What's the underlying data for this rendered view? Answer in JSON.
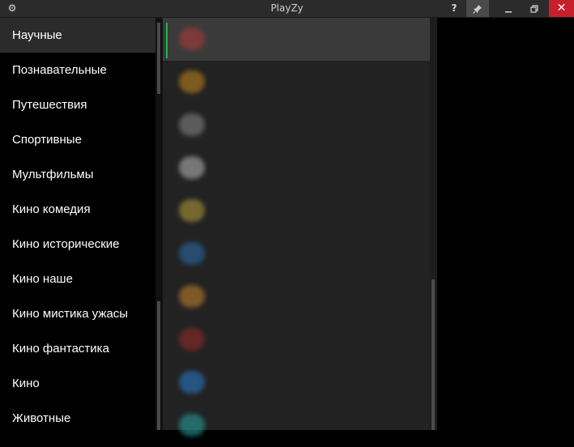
{
  "window": {
    "title": "PlayZy",
    "buttons": {
      "help": "?",
      "close": "✕"
    }
  },
  "sidebar": {
    "items": [
      {
        "label": "Научные"
      },
      {
        "label": "Познавательные"
      },
      {
        "label": "Путешествия"
      },
      {
        "label": "Спортивные"
      },
      {
        "label": "Мультфильмы"
      },
      {
        "label": "Кино комедия"
      },
      {
        "label": "Кино исторические"
      },
      {
        "label": "Кино наше"
      },
      {
        "label": "Кино мистика ужасы"
      },
      {
        "label": "Кино фантастика"
      },
      {
        "label": "Кино"
      },
      {
        "label": "Животные"
      }
    ],
    "selected_index": 0
  },
  "channels": {
    "blurred": true,
    "rows": [
      {
        "logo_color": "#b33a3a",
        "name": "",
        "subtitle": ""
      },
      {
        "logo_color": "#c98a1c",
        "name": "",
        "subtitle": ""
      },
      {
        "logo_color": "#8a8a8a",
        "name": "",
        "subtitle": ""
      },
      {
        "logo_color": "#bdbdbd",
        "name": "",
        "subtitle": ""
      },
      {
        "logo_color": "#b8a23a",
        "name": "",
        "subtitle": ""
      },
      {
        "logo_color": "#2a6fb0",
        "name": "",
        "subtitle": ""
      },
      {
        "logo_color": "#c9862a",
        "name": "",
        "subtitle": ""
      },
      {
        "logo_color": "#9a2a2a",
        "name": "",
        "subtitle": ""
      },
      {
        "logo_color": "#2a7fd0",
        "name": "",
        "subtitle": ""
      },
      {
        "logo_color": "#2aa8a8",
        "name": "",
        "subtitle": ""
      }
    ],
    "selected_index": 0
  },
  "colors": {
    "accent_selected": "#19b455",
    "close_button": "#c8202a",
    "sidebar_selected": "#2b2b2b"
  }
}
